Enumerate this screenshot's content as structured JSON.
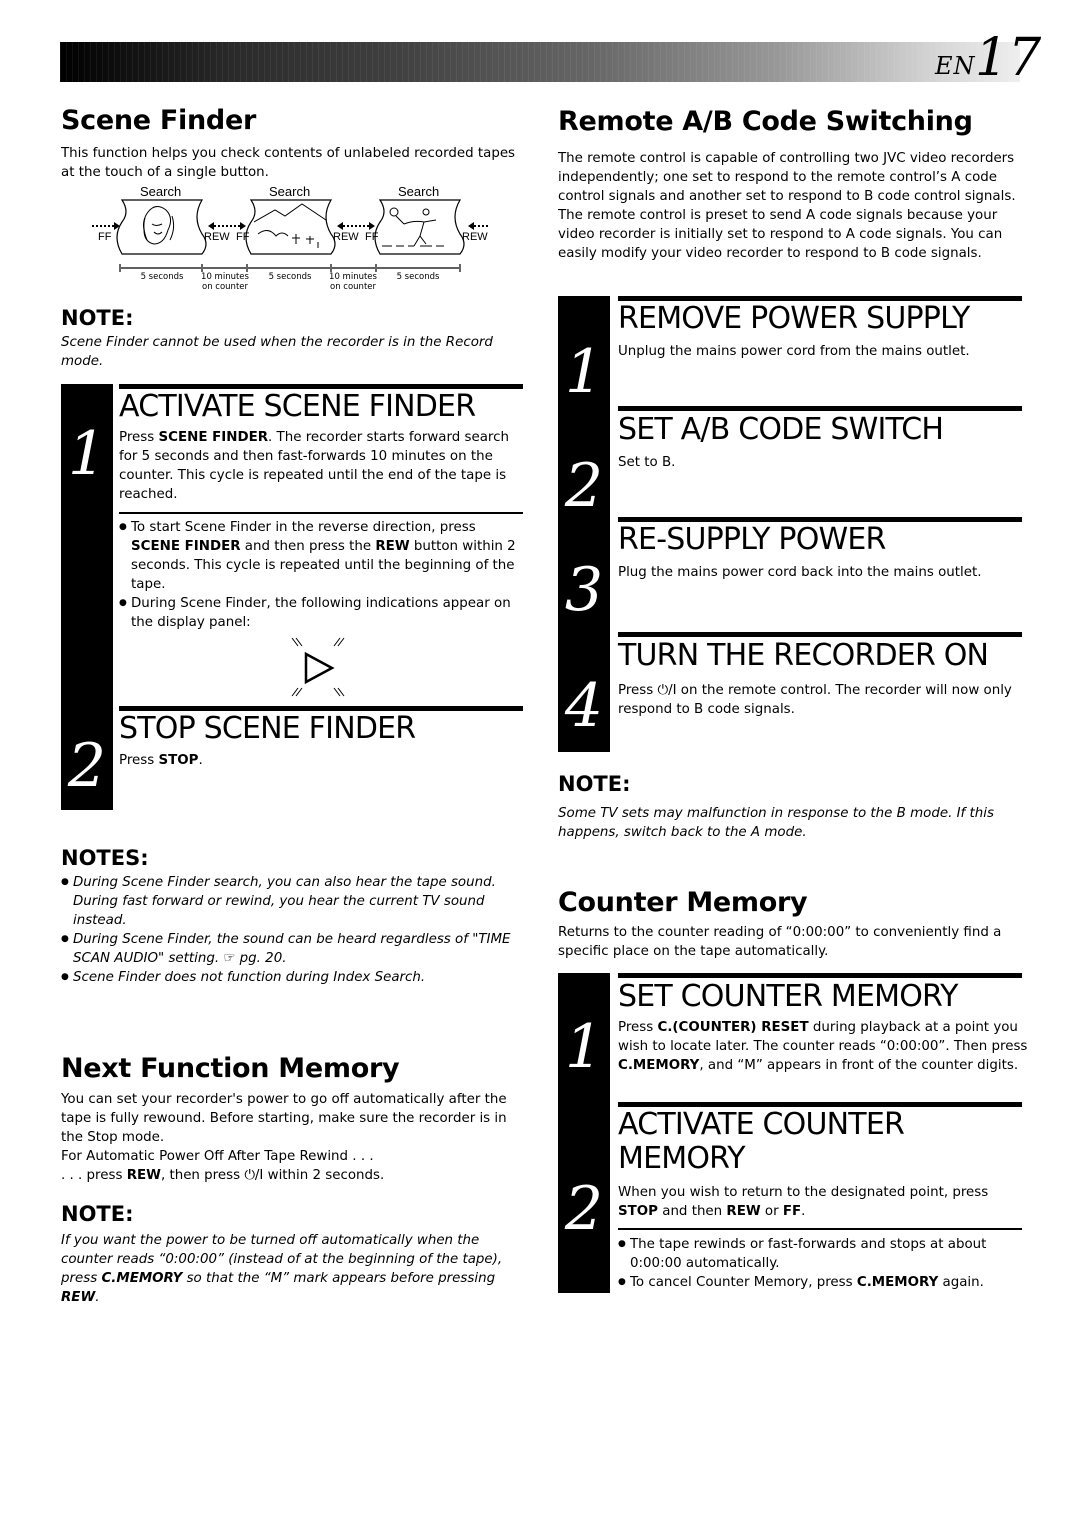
{
  "header": {
    "language_code": "EN",
    "page_number": "17"
  },
  "scene_finder": {
    "title": "Scene Finder",
    "intro": "This function helps you check contents of unlabeled recorded tapes at the touch of a single button.",
    "diagram": {
      "search_labels": [
        "Search",
        "Search",
        "Search"
      ],
      "direction_labels": [
        "FF",
        "REW",
        "FF",
        "REW",
        "FF",
        "REW"
      ],
      "interval_labels": [
        "5 seconds",
        "10 minutes",
        "5 seconds",
        "10 minutes",
        "5 seconds"
      ],
      "interval_sublabels": [
        "",
        "on counter",
        "",
        "on counter",
        ""
      ],
      "frames": [
        "portrait-scene",
        "mountain-scene",
        "tennis-scene"
      ]
    },
    "note": {
      "title": "NOTE:",
      "text": "Scene Finder cannot be used when the recorder is in the Record mode."
    },
    "steps": [
      {
        "number": "1",
        "heading": "ACTIVATE SCENE FINDER",
        "body_pre": "Press ",
        "body_bold": "SCENE FINDER",
        "body_post": ". The recorder starts forward search for 5 seconds and then fast-forwards 10 minutes on the counter. This cycle is repeated until the end of the tape is reached.",
        "bullets": [
          {
            "p1": "To start Scene Finder in the reverse direction, press ",
            "b1": "SCENE FINDER",
            "p2": " and then press the ",
            "b2": "REW",
            "p3": " button within 2 seconds. This cycle is repeated until the beginning of the tape."
          },
          {
            "p1": "During Scene Finder, the following indications appear on the display panel:"
          }
        ],
        "display_icon": "blinking-play-indicator"
      },
      {
        "number": "2",
        "heading": "STOP SCENE FINDER",
        "body_pre": "Press ",
        "body_bold": "STOP",
        "body_post": "."
      }
    ],
    "notes": {
      "title": "NOTES:",
      "items": [
        "During Scene Finder search, you can also hear the tape sound. During fast forward or rewind, you hear the current TV sound instead.",
        "During Scene Finder, the sound can be heard regardless of \"TIME SCAN AUDIO\" setting. ☞ pg. 20.",
        "Scene Finder does not function during Index Search."
      ]
    }
  },
  "next_function_memory": {
    "title": "Next Function Memory",
    "intro": "You can set your recorder's power to go off automatically after the tape is fully rewound. Before starting, make sure the recorder is in the Stop mode.",
    "line2": "For Automatic Power Off After Tape Rewind . . .",
    "line3_pre": ". . . press ",
    "line3_bold": "REW",
    "line3_post": ", then press ⏻/I within 2 seconds.",
    "note": {
      "title": "NOTE:",
      "p1": "If you want the power to be turned off automatically when the counter reads “0:00:00” (instead of at the beginning of the tape), press ",
      "b1": "C.MEMORY",
      "p2": " so that the “M” mark appears before pressing ",
      "b2": "REW",
      "p3": "."
    }
  },
  "remote_ab": {
    "title": "Remote A/B Code Switching",
    "intro": "The remote control is capable of controlling two JVC video recorders independently; one set to respond to the remote control’s A code control signals and another set to respond to B code control signals. The remote control is preset to send A code signals because your video recorder is initially set to respond to A code signals. You can easily modify your video recorder to respond to B code signals.",
    "steps": [
      {
        "number": "1",
        "heading": "REMOVE POWER SUPPLY",
        "body": "Unplug the mains power cord from the mains outlet."
      },
      {
        "number": "2",
        "heading": "SET A/B CODE SWITCH",
        "body": "Set to B."
      },
      {
        "number": "3",
        "heading": "RE-SUPPLY POWER",
        "body": "Plug the mains power cord back into the mains outlet."
      },
      {
        "number": "4",
        "heading": "TURN THE RECORDER ON",
        "body": "Press ⏻/I on the remote control. The recorder will now only respond to B code signals."
      }
    ],
    "note": {
      "title": "NOTE:",
      "text": "Some TV sets may malfunction in response to the B mode. If this happens, switch back to the A mode."
    }
  },
  "counter_memory": {
    "title": "Counter Memory",
    "intro": "Returns to the counter reading of “0:00:00” to conveniently find a specific place on the tape automatically.",
    "steps": [
      {
        "number": "1",
        "heading": "SET COUNTER MEMORY",
        "p1": "Press ",
        "b1": "C.(COUNTER) RESET",
        "p2": " during playback at a point you wish to locate later. The counter reads “0:00:00”. Then press ",
        "b2": "C.MEMORY",
        "p3": ", and “M” appears in front of the counter digits."
      },
      {
        "number": "2",
        "heading_line1": "ACTIVATE COUNTER",
        "heading_line2": "MEMORY",
        "p1": "When you wish to return to the designated point, press ",
        "b1": "STOP",
        "p2": " and then ",
        "b2": "REW",
        "p3": " or ",
        "b3": "FF",
        "p4": ".",
        "bullets": [
          {
            "p1": "The tape rewinds or fast-forwards and stops at about 0:00:00 automatically."
          },
          {
            "p1": "To cancel Counter Memory, press ",
            "b1": "C.MEMORY",
            "p2": " again."
          }
        ]
      }
    ]
  }
}
